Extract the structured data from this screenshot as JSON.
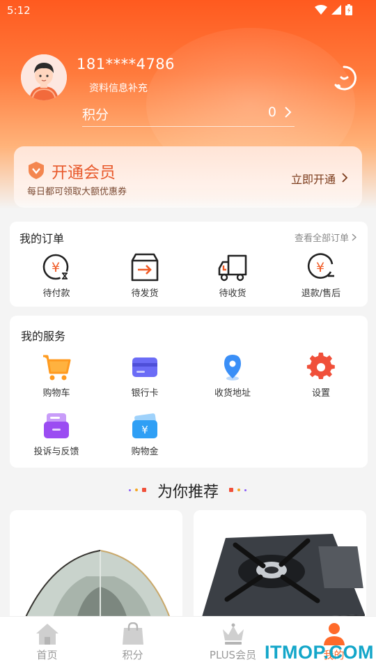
{
  "status_bar": {
    "time": "5:12"
  },
  "profile": {
    "phone": "181****4786",
    "complete_info_link": "资料信息补充",
    "points_label": "积分",
    "points_value": "0"
  },
  "vip_banner": {
    "title": "开通会员",
    "subtitle": "每日都可领取大额优惠券",
    "cta": "立即开通"
  },
  "orders": {
    "title": "我的订单",
    "view_all": "查看全部订单",
    "items": [
      {
        "label": "待付款",
        "icon": "yuan-clock-icon"
      },
      {
        "label": "待发货",
        "icon": "box-arrow-icon"
      },
      {
        "label": "待收货",
        "icon": "truck-icon"
      },
      {
        "label": "退款/售后",
        "icon": "yuan-refund-icon"
      }
    ]
  },
  "services": {
    "title": "我的服务",
    "items": [
      {
        "label": "购物车",
        "icon": "cart-icon",
        "color": "#ff9a1f"
      },
      {
        "label": "银行卡",
        "icon": "bank-card-icon",
        "color": "#6b6cf6"
      },
      {
        "label": "收货地址",
        "icon": "location-pin-icon",
        "color": "#3a8ff7"
      },
      {
        "label": "设置",
        "icon": "gear-icon",
        "color": "#f0503a"
      },
      {
        "label": "投诉与反馈",
        "icon": "feedback-icon",
        "color": "#9b4cf2"
      },
      {
        "label": "购物金",
        "icon": "wallet-icon",
        "color": "#2f9ff5"
      }
    ]
  },
  "recommend": {
    "title": "为你推荐"
  },
  "tabbar": {
    "items": [
      {
        "label": "首页",
        "icon": "home-icon"
      },
      {
        "label": "积分",
        "icon": "bag-icon"
      },
      {
        "label": "PLUS会员",
        "icon": "crown-icon"
      },
      {
        "label": "我的",
        "icon": "user-icon"
      }
    ],
    "active_index": 3
  },
  "watermark": "ITMOP.COM",
  "colors": {
    "accent": "#ff6a2a",
    "header": "#ff5a1f"
  }
}
